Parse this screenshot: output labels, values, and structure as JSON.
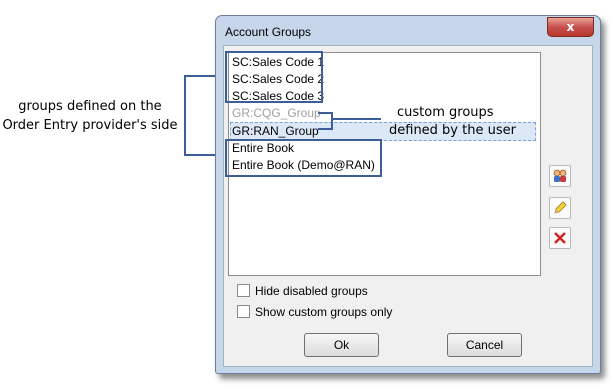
{
  "window": {
    "title": "Account Groups",
    "close_label": "x"
  },
  "list": {
    "items": [
      {
        "label": "SC:Sales Code 1",
        "disabled": false
      },
      {
        "label": "SC:Sales Code 2",
        "disabled": false
      },
      {
        "label": "SC:Sales Code 3",
        "disabled": false
      },
      {
        "label": "GR:CQG_Group",
        "disabled": true
      },
      {
        "label": "GR:RAN_Group",
        "disabled": false
      },
      {
        "label": "Entire Book",
        "disabled": false
      },
      {
        "label": "Entire Book (Demo@RAN)",
        "disabled": false
      }
    ]
  },
  "side_buttons": {
    "add_icon": "users-icon",
    "edit_icon": "pencil-icon",
    "delete_icon": "delete-icon"
  },
  "options": {
    "hide_disabled": "Hide disabled groups",
    "show_custom_only": "Show custom groups only"
  },
  "buttons": {
    "ok": "Ok",
    "cancel": "Cancel"
  },
  "annotations": {
    "left_line1": "groups defined on the",
    "left_line2": "Order Entry provider's side",
    "right_line1": "custom groups",
    "right_line2": "defined by the user"
  },
  "colors": {
    "accent": "#3c5f9a",
    "title_bar": "#c7d6ea",
    "close": "#c75050"
  }
}
